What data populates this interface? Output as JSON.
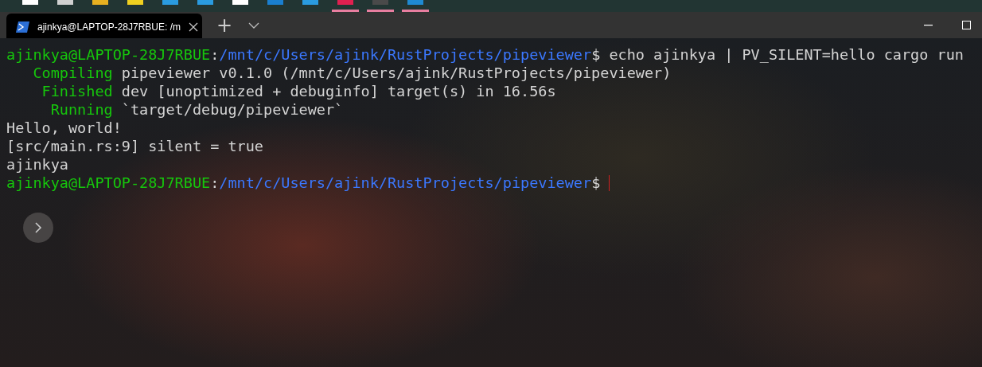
{
  "taskbar": {
    "apps": [
      {
        "color": "#ffffff",
        "running": false
      },
      {
        "color": "#d0d0d0",
        "running": false
      },
      {
        "color": "#e8b020",
        "running": false
      },
      {
        "color": "#f0d020",
        "running": false
      },
      {
        "color": "#2a9be0",
        "running": false
      },
      {
        "color": "#2a9be0",
        "running": false
      },
      {
        "color": "#ffffff",
        "running": false
      },
      {
        "color": "#1a7fd0",
        "running": false
      },
      {
        "color": "#2a9be0",
        "running": false
      },
      {
        "color": "#e02050",
        "running": true
      },
      {
        "color": "#4a4a4a",
        "running": true
      },
      {
        "color": "#1f8ad2",
        "running": true
      }
    ]
  },
  "tabs": [
    {
      "title": "ajinkya@LAPTOP-28J7RBUE: /m",
      "selected": true
    }
  ],
  "new_tab": "+",
  "terminal": {
    "lines": [
      [
        {
          "kind": "user",
          "text": "ajinkya@LAPTOP-28J7RBUE"
        },
        {
          "kind": "plain",
          "text": ":"
        },
        {
          "kind": "path",
          "text": "/mnt/c/Users/ajink/RustProjects/pipeviewer"
        },
        {
          "kind": "plain",
          "text": "$ echo ajinkya | PV_SILENT=hello cargo run"
        }
      ],
      [
        {
          "kind": "status",
          "text": "   Compiling"
        },
        {
          "kind": "plain",
          "text": " pipeviewer v0.1.0 (/mnt/c/Users/ajink/RustProjects/pipeviewer)"
        }
      ],
      [
        {
          "kind": "status",
          "text": "    Finished"
        },
        {
          "kind": "plain",
          "text": " dev [unoptimized + debuginfo] target(s) in 16.56s"
        }
      ],
      [
        {
          "kind": "status",
          "text": "     Running"
        },
        {
          "kind": "plain",
          "text": " `target/debug/pipeviewer`"
        }
      ],
      [
        {
          "kind": "plain",
          "text": "Hello, world!"
        }
      ],
      [
        {
          "kind": "plain",
          "text": "[src/main.rs:9] silent = true"
        }
      ],
      [
        {
          "kind": "plain",
          "text": "ajinkya"
        }
      ],
      [
        {
          "kind": "user",
          "text": "ajinkya@LAPTOP-28J7RBUE"
        },
        {
          "kind": "plain",
          "text": ":"
        },
        {
          "kind": "path",
          "text": "/mnt/c/Users/ajink/RustProjects/pipeviewer"
        },
        {
          "kind": "plain",
          "text": "$ "
        },
        {
          "kind": "cursor"
        }
      ]
    ]
  }
}
